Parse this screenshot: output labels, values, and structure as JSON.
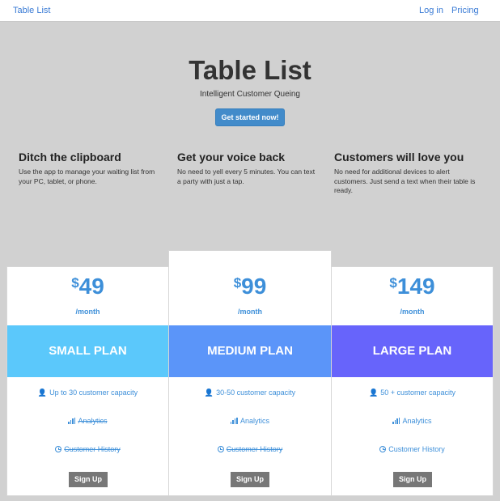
{
  "nav": {
    "brand": "Table List",
    "login": "Log in",
    "pricing": "Pricing"
  },
  "hero": {
    "title": "Table List",
    "subtitle": "Intelligent Customer Queing",
    "cta": "Get started now!"
  },
  "features": [
    {
      "title": "Ditch the clipboard",
      "text": "Use the app to manage your waiting list from your PC, tablet, or phone."
    },
    {
      "title": "Get your voice back",
      "text": "No need to yell every 5 minutes. You can text a party with just a tap."
    },
    {
      "title": "Customers will love you",
      "text": "No need for additional devices to alert customers. Just send a text when their table is ready."
    }
  ],
  "plans": [
    {
      "currency": "$",
      "price": "49",
      "period": "/month",
      "name": "SMALL PLAN",
      "color": "#5bc8fb",
      "capacity": "Up to 30 customer capacity",
      "analytics": "Analytics",
      "history": "Customer History",
      "analytics_included": false,
      "history_included": false,
      "button": "Sign Up"
    },
    {
      "currency": "$",
      "price": "99",
      "period": "/month",
      "name": "MEDIUM PLAN",
      "color": "#5b95f9",
      "capacity": "30-50 customer capacity",
      "analytics": "Analytics",
      "history": "Customer History",
      "analytics_included": true,
      "history_included": false,
      "button": "Sign Up"
    },
    {
      "currency": "$",
      "price": "149",
      "period": "/month",
      "name": "LARGE PLAN",
      "color": "#6764fb",
      "capacity": "50 + customer capacity",
      "analytics": "Analytics",
      "history": "Customer History",
      "analytics_included": true,
      "history_included": true,
      "button": "Sign Up"
    }
  ],
  "icons": {
    "capacity": "user-icon",
    "analytics": "bar-chart-icon",
    "history": "clock-icon"
  }
}
